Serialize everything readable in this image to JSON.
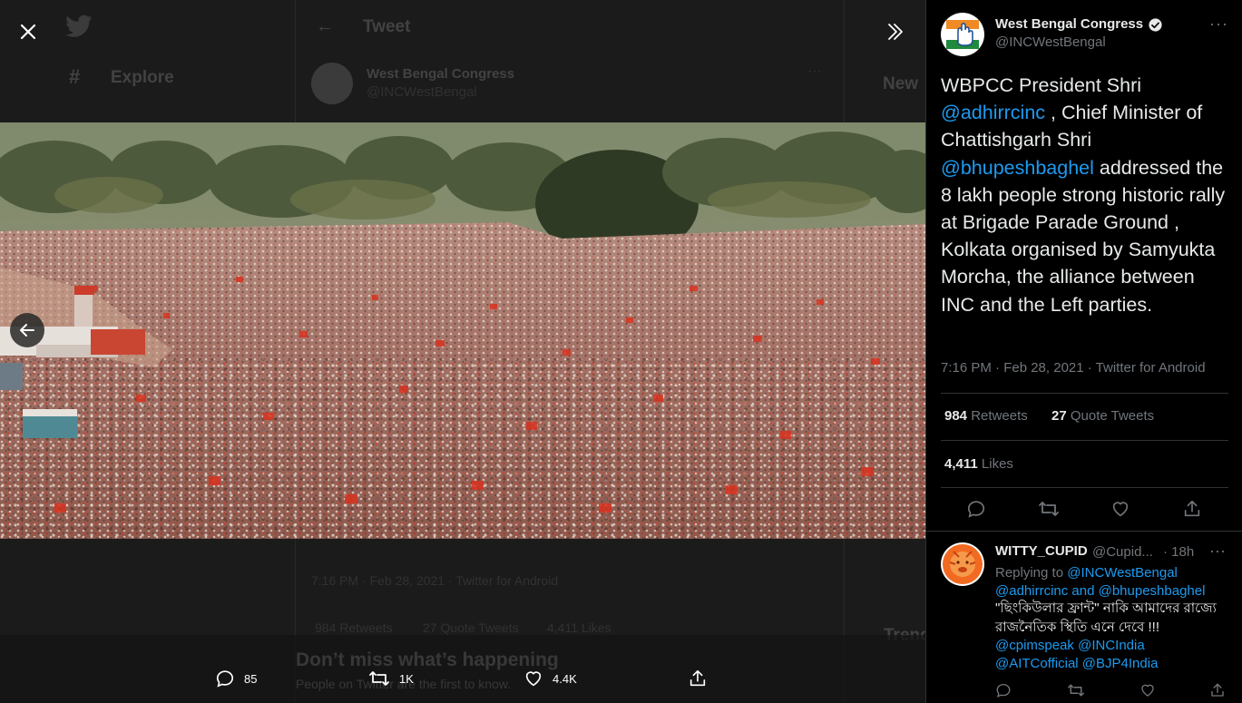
{
  "background": {
    "header_title": "Tweet",
    "explore_label": "Explore",
    "author_name": "West Bengal Congress",
    "author_handle": "@INCWestBengal",
    "meta": "7:16 PM · Feb 28, 2021 · Twitter for Android",
    "retweets": "984 Retweets",
    "quotes": "27 Quote Tweets",
    "likes": "4,411 Likes",
    "banner_title": "Don’t miss what’s happening",
    "banner_sub": "People on Twitter are the first to know.",
    "new_label": "New",
    "trends_label": "Trends"
  },
  "viewer": {
    "photo_alt": "Aerial view of a massive crowd rally at Brigade Parade Ground, Kolkata",
    "actions": {
      "reply_count": "85",
      "retweet_count": "1K",
      "like_count": "4.4K"
    }
  },
  "tweet": {
    "author_name": "West Bengal Congress",
    "author_handle": "@INCWestBengal",
    "text": {
      "p1": "WBPCC President Shri ",
      "m1": "@adhirrcinc",
      "p2": " , Chief Minister of Chattishgarh Shri ",
      "m2": "@bhupeshbaghel",
      "p3": " addressed the 8 lakh people strong historic rally at Brigade Parade Ground , Kolkata organised by Samyukta Morcha, the alliance between INC and the Left parties."
    },
    "meta": "7:16 PM · Feb 28, 2021 · Twitter for Android",
    "stats": {
      "retweets_num": "984",
      "retweets_label": "Retweets",
      "quotes_num": "27",
      "quotes_label": "Quote Tweets",
      "likes_num": "4,411",
      "likes_label": "Likes"
    }
  },
  "reply": {
    "author_name": "WITTY_CUPID",
    "author_handle": "@Cupid...",
    "time": "· 18h",
    "replying_label": "Replying to ",
    "replying_to1": "@INCWestBengal",
    "replying_to2": "@adhirrcinc and @bhupeshbaghel",
    "text": "\"ছিংকিউলার ফ্রান্ট\" নাকি আমাদের রাজ্যে রাজনৈতিক স্থিতি এনে দেবে !!!",
    "tags_line1": "@cpimspeak @INCIndia",
    "tags_line2": "@AITCofficial @BJP4India"
  },
  "colors": {
    "accent": "#1d9bf0",
    "text_primary": "#e7e9ea",
    "text_secondary": "#71767b",
    "background": "#000000"
  },
  "icons": [
    "close-icon",
    "expand-icon",
    "arrow-left-icon",
    "reply-icon",
    "retweet-icon",
    "like-icon",
    "share-icon",
    "verified-icon",
    "more-icon"
  ]
}
